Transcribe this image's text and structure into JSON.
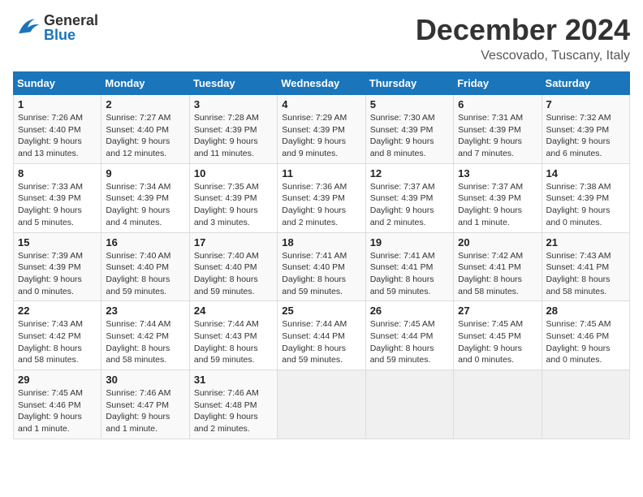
{
  "header": {
    "logo_general": "General",
    "logo_blue": "Blue",
    "month_title": "December 2024",
    "location": "Vescovado, Tuscany, Italy"
  },
  "calendar": {
    "days_of_week": [
      "Sunday",
      "Monday",
      "Tuesday",
      "Wednesday",
      "Thursday",
      "Friday",
      "Saturday"
    ],
    "weeks": [
      [
        {
          "day": "1",
          "sunrise": "7:26 AM",
          "sunset": "4:40 PM",
          "daylight": "9 hours and 13 minutes."
        },
        {
          "day": "2",
          "sunrise": "7:27 AM",
          "sunset": "4:40 PM",
          "daylight": "9 hours and 12 minutes."
        },
        {
          "day": "3",
          "sunrise": "7:28 AM",
          "sunset": "4:39 PM",
          "daylight": "9 hours and 11 minutes."
        },
        {
          "day": "4",
          "sunrise": "7:29 AM",
          "sunset": "4:39 PM",
          "daylight": "9 hours and 9 minutes."
        },
        {
          "day": "5",
          "sunrise": "7:30 AM",
          "sunset": "4:39 PM",
          "daylight": "9 hours and 8 minutes."
        },
        {
          "day": "6",
          "sunrise": "7:31 AM",
          "sunset": "4:39 PM",
          "daylight": "9 hours and 7 minutes."
        },
        {
          "day": "7",
          "sunrise": "7:32 AM",
          "sunset": "4:39 PM",
          "daylight": "9 hours and 6 minutes."
        }
      ],
      [
        {
          "day": "8",
          "sunrise": "7:33 AM",
          "sunset": "4:39 PM",
          "daylight": "9 hours and 5 minutes."
        },
        {
          "day": "9",
          "sunrise": "7:34 AM",
          "sunset": "4:39 PM",
          "daylight": "9 hours and 4 minutes."
        },
        {
          "day": "10",
          "sunrise": "7:35 AM",
          "sunset": "4:39 PM",
          "daylight": "9 hours and 3 minutes."
        },
        {
          "day": "11",
          "sunrise": "7:36 AM",
          "sunset": "4:39 PM",
          "daylight": "9 hours and 2 minutes."
        },
        {
          "day": "12",
          "sunrise": "7:37 AM",
          "sunset": "4:39 PM",
          "daylight": "9 hours and 2 minutes."
        },
        {
          "day": "13",
          "sunrise": "7:37 AM",
          "sunset": "4:39 PM",
          "daylight": "9 hours and 1 minute."
        },
        {
          "day": "14",
          "sunrise": "7:38 AM",
          "sunset": "4:39 PM",
          "daylight": "9 hours and 0 minutes."
        }
      ],
      [
        {
          "day": "15",
          "sunrise": "7:39 AM",
          "sunset": "4:39 PM",
          "daylight": "9 hours and 0 minutes."
        },
        {
          "day": "16",
          "sunrise": "7:40 AM",
          "sunset": "4:40 PM",
          "daylight": "8 hours and 59 minutes."
        },
        {
          "day": "17",
          "sunrise": "7:40 AM",
          "sunset": "4:40 PM",
          "daylight": "8 hours and 59 minutes."
        },
        {
          "day": "18",
          "sunrise": "7:41 AM",
          "sunset": "4:40 PM",
          "daylight": "8 hours and 59 minutes."
        },
        {
          "day": "19",
          "sunrise": "7:41 AM",
          "sunset": "4:41 PM",
          "daylight": "8 hours and 59 minutes."
        },
        {
          "day": "20",
          "sunrise": "7:42 AM",
          "sunset": "4:41 PM",
          "daylight": "8 hours and 58 minutes."
        },
        {
          "day": "21",
          "sunrise": "7:43 AM",
          "sunset": "4:41 PM",
          "daylight": "8 hours and 58 minutes."
        }
      ],
      [
        {
          "day": "22",
          "sunrise": "7:43 AM",
          "sunset": "4:42 PM",
          "daylight": "8 hours and 58 minutes."
        },
        {
          "day": "23",
          "sunrise": "7:44 AM",
          "sunset": "4:42 PM",
          "daylight": "8 hours and 58 minutes."
        },
        {
          "day": "24",
          "sunrise": "7:44 AM",
          "sunset": "4:43 PM",
          "daylight": "8 hours and 59 minutes."
        },
        {
          "day": "25",
          "sunrise": "7:44 AM",
          "sunset": "4:44 PM",
          "daylight": "8 hours and 59 minutes."
        },
        {
          "day": "26",
          "sunrise": "7:45 AM",
          "sunset": "4:44 PM",
          "daylight": "8 hours and 59 minutes."
        },
        {
          "day": "27",
          "sunrise": "7:45 AM",
          "sunset": "4:45 PM",
          "daylight": "9 hours and 0 minutes."
        },
        {
          "day": "28",
          "sunrise": "7:45 AM",
          "sunset": "4:46 PM",
          "daylight": "9 hours and 0 minutes."
        }
      ],
      [
        {
          "day": "29",
          "sunrise": "7:45 AM",
          "sunset": "4:46 PM",
          "daylight": "9 hours and 1 minute."
        },
        {
          "day": "30",
          "sunrise": "7:46 AM",
          "sunset": "4:47 PM",
          "daylight": "9 hours and 1 minute."
        },
        {
          "day": "31",
          "sunrise": "7:46 AM",
          "sunset": "4:48 PM",
          "daylight": "9 hours and 2 minutes."
        },
        null,
        null,
        null,
        null
      ]
    ]
  }
}
